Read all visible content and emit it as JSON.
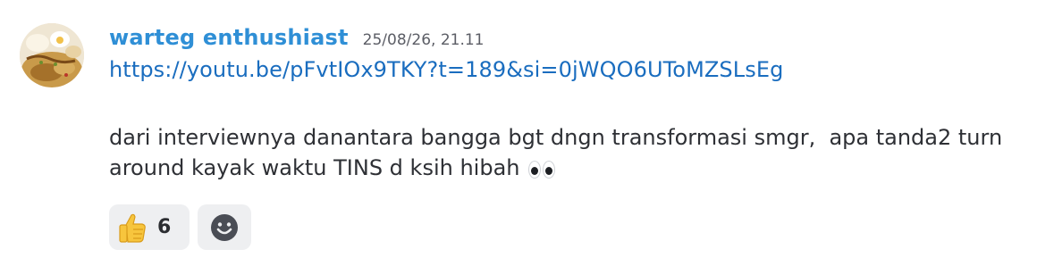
{
  "message": {
    "author": "warteg enthushiast",
    "timestamp": "25/08/26, 21.11",
    "link": "https://youtu.be/pFvtIOx9TKY?t=189&si=0jWQO6UToMZSLsEg",
    "text": "dari interviewnya danantara bangga bgt dngn transformasi smgr,  apa tanda2 turn around kayak waktu TINS d ksih hibah",
    "trailing_emoji": "eyes-emoji"
  },
  "reactions": [
    {
      "emoji": "thumbs-up-icon",
      "count": "6"
    }
  ],
  "add_reaction": {
    "icon": "smiley-face-icon"
  },
  "colors": {
    "username": "#2f8fd6",
    "link": "#1a6dbf",
    "reaction_bg": "#eeeff1"
  }
}
